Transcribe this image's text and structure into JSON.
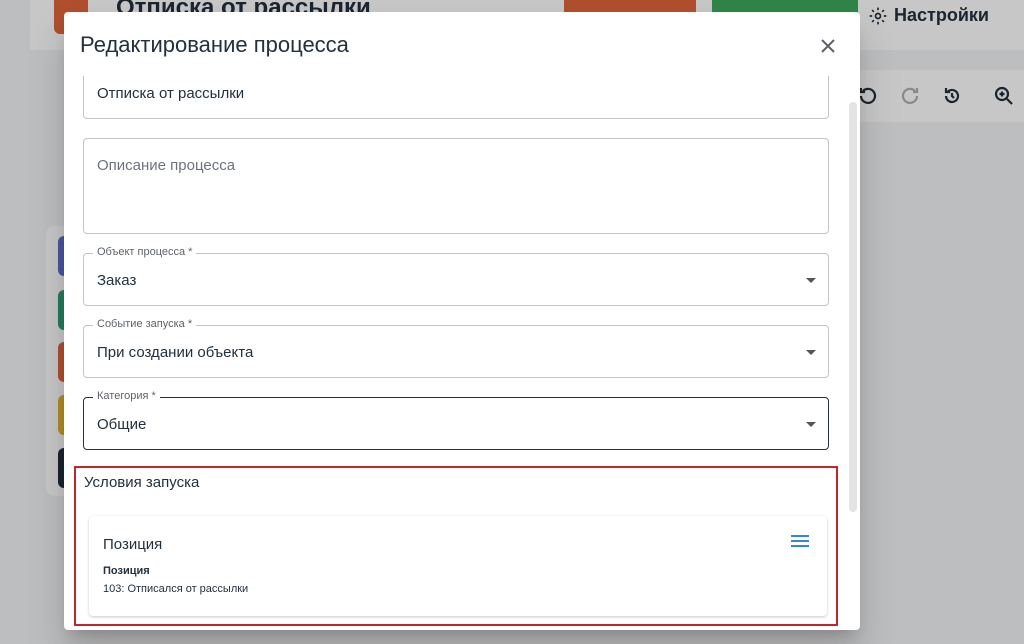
{
  "background": {
    "app_title": "Отписка от рассылки",
    "settings_label": "Настройки"
  },
  "modal": {
    "title": "Редактирование процесса",
    "name_value": "Отписка от рассылки",
    "description_placeholder": "Описание процесса",
    "object_field": {
      "label": "Объект процесса *",
      "value": "Заказ"
    },
    "trigger_field": {
      "label": "Событие запуска *",
      "value": "При создании объекта"
    },
    "category_field": {
      "label": "Категория *",
      "value": "Общие"
    },
    "conditions": {
      "title": "Условия запуска",
      "card": {
        "title": "Позиция",
        "label": "Позиция",
        "value": "103: Отписался от рассылки"
      }
    }
  },
  "colors": {
    "accent": "#1976d2",
    "highlight_border": "#c0272d",
    "orange": "#e0663b",
    "green": "#3faa5c"
  }
}
